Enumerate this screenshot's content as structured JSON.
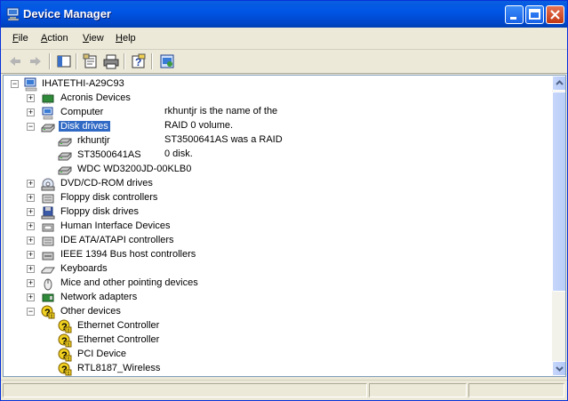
{
  "window": {
    "title": "Device Manager"
  },
  "menu": [
    {
      "label": "File",
      "key": "F",
      "rest": "ile"
    },
    {
      "label": "Action",
      "key": "A",
      "rest": "ction"
    },
    {
      "label": "View",
      "key": "V",
      "rest": "iew"
    },
    {
      "label": "Help",
      "key": "H",
      "rest": "elp"
    }
  ],
  "toolbar": [
    "back-arrow",
    "forward-arrow",
    "show-hide-console-tree",
    "properties",
    "print",
    "help",
    "update-driver"
  ],
  "tree": {
    "root": "IHATETHI-A29C93",
    "items": [
      {
        "label": "Acronis Devices",
        "icon": "chip-icon",
        "expander": "+"
      },
      {
        "label": "Computer",
        "icon": "computer-icon",
        "expander": "+"
      },
      {
        "label": "Disk drives",
        "icon": "disk-drive-icon",
        "expander": "-",
        "selected": true
      },
      {
        "label": "rkhuntjr",
        "icon": "disk-drive-icon",
        "child": true
      },
      {
        "label": "ST3500641AS",
        "icon": "disk-drive-icon",
        "child": true
      },
      {
        "label": "WDC WD3200JD-00KLB0",
        "icon": "disk-drive-icon",
        "child": true
      },
      {
        "label": "DVD/CD-ROM drives",
        "icon": "cd-icon",
        "expander": "+"
      },
      {
        "label": "Floppy disk controllers",
        "icon": "controller-icon",
        "expander": "+"
      },
      {
        "label": "Floppy disk drives",
        "icon": "floppy-icon",
        "expander": "+"
      },
      {
        "label": "Human Interface Devices",
        "icon": "hid-icon",
        "expander": "+"
      },
      {
        "label": "IDE ATA/ATAPI controllers",
        "icon": "controller-icon",
        "expander": "+"
      },
      {
        "label": "IEEE 1394 Bus host controllers",
        "icon": "firewire-icon",
        "expander": "+"
      },
      {
        "label": "Keyboards",
        "icon": "keyboard-icon",
        "expander": "+"
      },
      {
        "label": "Mice and other pointing devices",
        "icon": "mouse-icon",
        "expander": "+"
      },
      {
        "label": "Network adapters",
        "icon": "network-icon",
        "expander": "+"
      },
      {
        "label": "Other devices",
        "icon": "unknown-device-icon",
        "expander": "-"
      },
      {
        "label": "Ethernet Controller",
        "icon": "unknown-device-icon",
        "child": true
      },
      {
        "label": "Ethernet Controller",
        "icon": "unknown-device-icon",
        "child": true
      },
      {
        "label": "PCI Device",
        "icon": "unknown-device-icon",
        "child": true
      },
      {
        "label": "RTL8187_Wireless",
        "icon": "unknown-device-icon",
        "child": true
      }
    ]
  },
  "note": {
    "line1": "rkhuntjr is the name of the",
    "line2": "RAID 0 volume.",
    "line3": "ST3500641AS was a RAID",
    "line4": "0 disk."
  },
  "colors": {
    "titlebar": "#0055e5",
    "selection": "#316ac5",
    "window_bg": "#ece9d8"
  }
}
